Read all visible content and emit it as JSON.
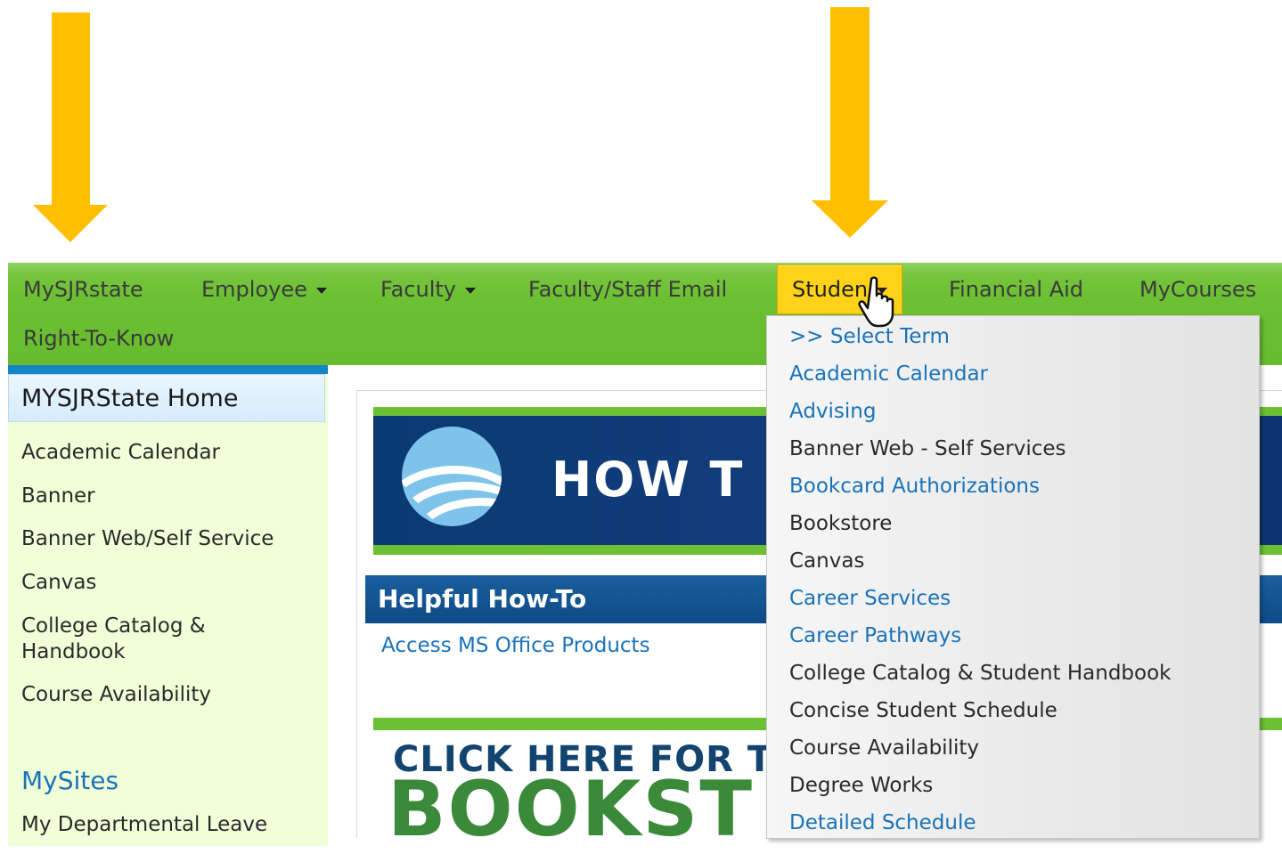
{
  "colors": {
    "annotation_arrow": "#FFBF00",
    "nav_green": "#6cc033",
    "active_tab": "#FFD21A",
    "link_blue": "#1a73b8",
    "sidebar_accent": "#1485c7"
  },
  "annotations": [
    {
      "name": "arrow-down-icon",
      "points_to": "MySJRstate"
    },
    {
      "name": "arrow-down-icon",
      "points_to": "Students"
    }
  ],
  "topnav": {
    "items": [
      {
        "label": "MySJRstate",
        "has_menu": false
      },
      {
        "label": "Employee",
        "has_menu": true
      },
      {
        "label": "Faculty",
        "has_menu": true
      },
      {
        "label": "Faculty/Staff Email",
        "has_menu": false
      },
      {
        "label": "Studen",
        "has_menu": true,
        "active": true
      },
      {
        "label": "Financial Aid",
        "has_menu": false
      },
      {
        "label": "MyCourses",
        "has_menu": false
      },
      {
        "label": "Right-To-Know",
        "has_menu": false
      }
    ]
  },
  "sidebar": {
    "home": "MYSJRState Home",
    "items": [
      "Academic Calendar",
      "Banner",
      "Banner Web/Self Service",
      "Canvas",
      "College Catalog &",
      "Handbook",
      "Course Availability"
    ],
    "section_title": "MySites",
    "section_items": [
      "My Departmental Leave"
    ]
  },
  "content": {
    "howto_banner_text": "HOW T",
    "helpful_title": "Helpful How-To",
    "helpful_link": "Access MS Office Products",
    "bookstore_line1": "CLICK HERE FOR T",
    "bookstore_line2": "BOOKST"
  },
  "dropdown": {
    "items": [
      {
        "label": ">> Select Term",
        "style": "link"
      },
      {
        "label": "Academic Calendar",
        "style": "link"
      },
      {
        "label": "Advising",
        "style": "link"
      },
      {
        "label": "Banner Web - Self Services",
        "style": "plain"
      },
      {
        "label": "Bookcard Authorizations",
        "style": "link"
      },
      {
        "label": "Bookstore",
        "style": "plain"
      },
      {
        "label": "Canvas",
        "style": "plain"
      },
      {
        "label": "Career Services",
        "style": "link"
      },
      {
        "label": "Career Pathways",
        "style": "link"
      },
      {
        "label": "College Catalog & Student Handbook",
        "style": "plain"
      },
      {
        "label": "Concise Student Schedule",
        "style": "plain"
      },
      {
        "label": "Course Availability",
        "style": "plain"
      },
      {
        "label": "Degree Works",
        "style": "plain"
      },
      {
        "label": "Detailed Schedule",
        "style": "link"
      }
    ]
  },
  "cursor": {
    "icon": "hand-pointer-icon"
  }
}
